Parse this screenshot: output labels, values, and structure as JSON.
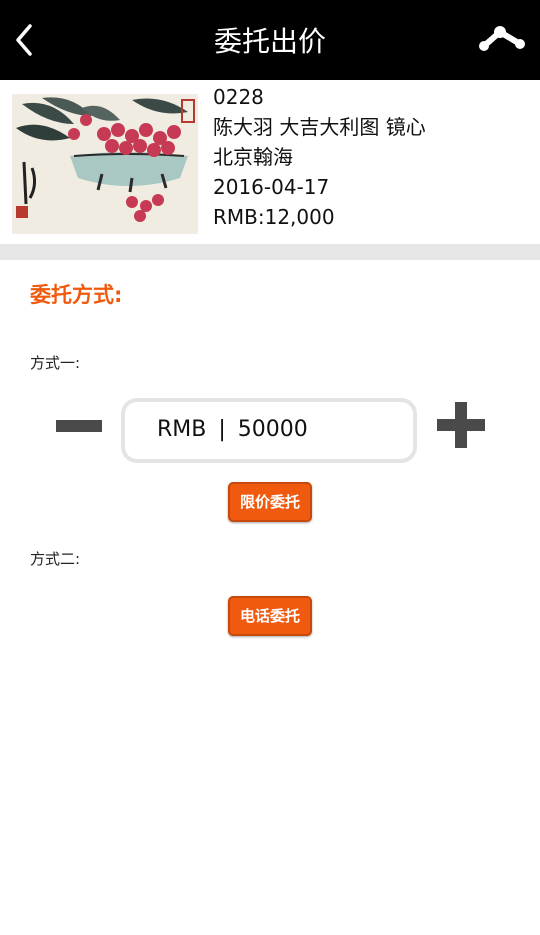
{
  "header": {
    "title": "委托出价",
    "back_icon": "chevron-left-icon",
    "share_icon": "share-icon"
  },
  "lot": {
    "lot_number": "0228",
    "name": "陈大羽 大吉大利图 镜心",
    "auction_house": "北京翰海",
    "date": "2016-04-17",
    "estimate": "RMB:12,000"
  },
  "commission": {
    "heading": "委托方式:",
    "method_one_label": "方式一:",
    "currency": "RMB",
    "separator": "|",
    "amount": "50000",
    "limit_button": "限价委托",
    "method_two_label": "方式二:",
    "phone_button": "电话委托"
  },
  "colors": {
    "accent": "#f05a0e",
    "header_bg": "#000000",
    "divider": "#e6e6e6"
  }
}
